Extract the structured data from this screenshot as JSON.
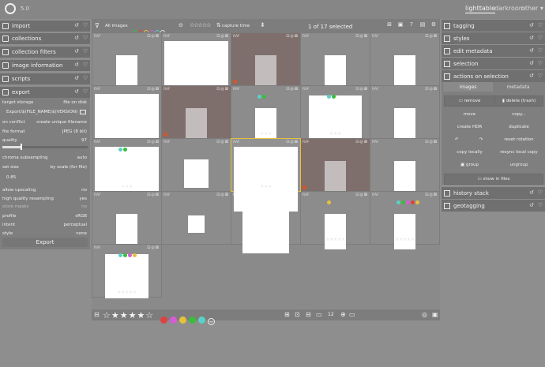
{
  "app": {
    "version": "5.0"
  },
  "views": {
    "lighttable": "lighttable",
    "darkroom": "darkroom",
    "other": "other"
  },
  "left_modules": [
    {
      "label": "import",
      "icon": "import-icon"
    },
    {
      "label": "collections",
      "icon": "collections-icon"
    },
    {
      "label": "collection filters",
      "icon": "filter-icon"
    },
    {
      "label": "image information",
      "icon": "info-icon"
    },
    {
      "label": "scripts",
      "icon": "scripts-icon"
    },
    {
      "label": "export",
      "icon": "export-icon"
    }
  ],
  "export": {
    "target_storage_label": "target storage",
    "target_storage_value": "file on disk",
    "path": "Export/$(FILE_NAME)$(VERSION)",
    "on_conflict_label": "on conflict",
    "on_conflict_value": "create unique filename",
    "file_format_label": "file format",
    "file_format_value": "JPEG (8 bit)",
    "quality_label": "quality",
    "quality_value": "97",
    "chroma_label": "chroma subsampling",
    "chroma_value": "auto",
    "set_size_label": "set size",
    "set_size_value": "by scale (for file)",
    "scale_value": "0.85",
    "upscaling_label": "allow upscaling",
    "upscaling_value": "no",
    "hq_label": "high quality resampling",
    "hq_value": "yes",
    "store_masks_label": "store masks",
    "store_masks_value": "no",
    "profile_label": "profile",
    "profile_value": "sRGB",
    "intent_label": "intent",
    "intent_value": "perceptual",
    "style_label": "style",
    "style_value": "none",
    "button": "Export"
  },
  "toolbar": {
    "images_select": "All images",
    "sort_label": "capture time",
    "selection_count": "1 of 17 selected"
  },
  "thumbnails": [
    {
      "tag": "RAF",
      "stars": "",
      "dots": [],
      "dark": false,
      "reject": false,
      "active": false
    },
    {
      "tag": "RAF",
      "stars": "",
      "dots": [],
      "dark": false,
      "reject": false,
      "active": false
    },
    {
      "tag": "RAF",
      "stars": "",
      "dots": [],
      "dark": true,
      "reject": true,
      "active": false
    },
    {
      "tag": "RAF",
      "stars": "",
      "dots": [],
      "dark": false,
      "reject": false,
      "active": false
    },
    {
      "tag": "RAF",
      "stars": "",
      "dots": [],
      "dark": false,
      "reject": false,
      "active": false
    },
    {
      "tag": "RAF",
      "stars": "",
      "dots": [],
      "dark": false,
      "reject": false,
      "active": false
    },
    {
      "tag": "RAF",
      "stars": "",
      "dots": [],
      "dark": true,
      "reject": true,
      "active": false
    },
    {
      "tag": "RAF",
      "stars": "★★★",
      "dots": [
        "#59d2c6",
        "#3bbd3b"
      ],
      "dark": false,
      "reject": false,
      "active": false
    },
    {
      "tag": "RAF",
      "stars": "★★★",
      "dots": [
        "#59d2c6",
        "#3bbd3b"
      ],
      "dark": false,
      "reject": false,
      "active": false
    },
    {
      "tag": "RAF",
      "stars": "",
      "dots": [],
      "dark": false,
      "reject": false,
      "active": false
    },
    {
      "tag": "RAF",
      "stars": "★★★",
      "dots": [
        "#59d2c6",
        "#3bbd3b"
      ],
      "dark": false,
      "reject": false,
      "active": false
    },
    {
      "tag": "RAF",
      "stars": "",
      "dots": [],
      "dark": false,
      "reject": false,
      "active": false
    },
    {
      "tag": "RAF",
      "stars": "★★★",
      "dots": [],
      "dark": false,
      "reject": false,
      "active": true
    },
    {
      "tag": "RAF",
      "stars": "",
      "dots": [],
      "dark": true,
      "reject": true,
      "active": false
    },
    {
      "tag": "RAF",
      "stars": "",
      "dots": [],
      "dark": false,
      "reject": false,
      "active": false
    },
    {
      "tag": "RAF",
      "stars": "",
      "dots": [],
      "dark": false,
      "reject": false,
      "active": false
    },
    {
      "tag": "RAF",
      "stars": "",
      "dots": [],
      "dark": false,
      "reject": false,
      "active": false
    },
    {
      "tag": "RAF",
      "stars": "",
      "dots": [],
      "dark": false,
      "reject": false,
      "active": false
    },
    {
      "tag": "RAF",
      "stars": "★★★★★",
      "dots": [
        "#e6c23c"
      ],
      "dark": false,
      "reject": false,
      "active": false
    },
    {
      "tag": "RAF",
      "stars": "★★★★★",
      "dots": [
        "#59d2c6",
        "#3bbd3b",
        "#d65cd6",
        "#e04040",
        "#e6c23c"
      ],
      "dark": false,
      "reject": false,
      "active": false
    },
    {
      "tag": "RAF",
      "stars": "★★★★★",
      "dots": [
        "#59d2c6",
        "#3bbd3b",
        "#d65cd6",
        "#e6c23c"
      ],
      "dark": false,
      "reject": false,
      "active": false
    }
  ],
  "bottom": {
    "zoom_value": "12",
    "label_colors": [
      "#e04040",
      "#d65cd6",
      "#e6c23c",
      "#3bbd3b",
      "#59d2c6"
    ]
  },
  "right_modules": [
    {
      "label": "tagging",
      "icon": "tag-icon"
    },
    {
      "label": "styles",
      "icon": "styles-icon"
    },
    {
      "label": "edit metadata",
      "icon": "metadata-icon"
    },
    {
      "label": "selection",
      "icon": "selection-icon"
    },
    {
      "label": "actions on selection",
      "icon": "actions-icon"
    }
  ],
  "actions": {
    "tab_images": "images",
    "tab_metadata": "metadata",
    "remove": "remove",
    "delete": "delete (trash)",
    "move": "move",
    "copy": "copy...",
    "create_hdr": "create HDR",
    "duplicate": "duplicate",
    "reset_rotation": "reset rotation",
    "copy_locally": "copy locally",
    "resync": "resync local copy",
    "group": "group",
    "ungroup": "ungroup",
    "show_in_files": "show in files"
  },
  "right_lower": [
    {
      "label": "history stack",
      "icon": "history-icon"
    },
    {
      "label": "geotagging",
      "icon": "map-icon"
    }
  ]
}
